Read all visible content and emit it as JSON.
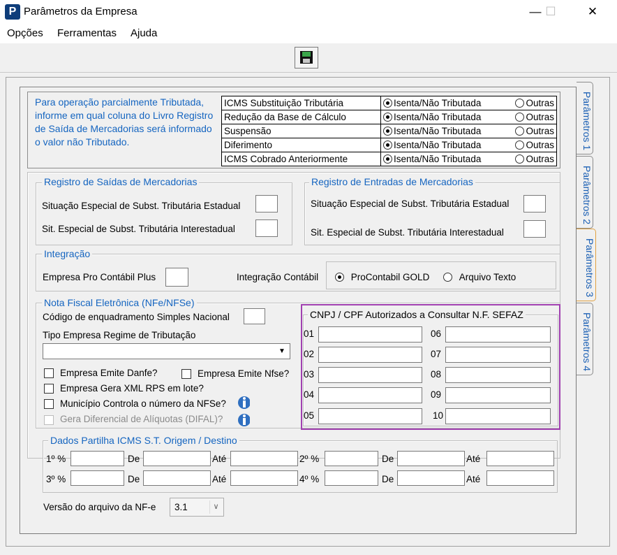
{
  "window": {
    "title": "Parâmetros da Empresa",
    "minimize": "—",
    "maximize": "☐",
    "close": "✕",
    "icon_letter": "P"
  },
  "menu": {
    "items": [
      "Opções",
      "Ferramentas",
      "Ajuda"
    ]
  },
  "toolbar": {
    "save_icon": "floppy-disk-icon"
  },
  "tabs": [
    "Parâmetros 1",
    "Parâmetros 2",
    "Parâmetros 3",
    "Parâmetros 4"
  ],
  "info": {
    "lines": [
      "Para operação parcialmente Tributada,",
      "informe em qual coluna do Livro Registro",
      "de Saída de Mercadorias será informado",
      "o valor não Tributado."
    ]
  },
  "icms_table": {
    "rows": [
      {
        "label": "ICMS Substituição Tributária",
        "opt1": "Isenta/Não Tributada",
        "opt2": "Outras",
        "selected": 1
      },
      {
        "label": "Redução da Base de Cálculo",
        "opt1": "Isenta/Não Tributada",
        "opt2": "Outras",
        "selected": 1
      },
      {
        "label": "Suspensão",
        "opt1": "Isenta/Não Tributada",
        "opt2": "Outras",
        "selected": 1
      },
      {
        "label": "Diferimento",
        "opt1": "Isenta/Não Tributada",
        "opt2": "Outras",
        "selected": 1
      },
      {
        "label": "ICMS Cobrado Anteriormente",
        "opt1": "Isenta/Não Tributada",
        "opt2": "Outras",
        "selected": 1
      }
    ]
  },
  "saidas": {
    "title": "Registro de Saídas de Mercadorias",
    "estadual": "Situação Especial de Subst. Tributária Estadual",
    "interestadual": "Sit. Especial de Subst. Tributária Interestadual"
  },
  "entradas": {
    "title": "Registro de Entradas de Mercadorias",
    "estadual": "Situação Especial de Subst. Tributária Estadual",
    "interestadual": "Sit. Especial de Subst. Tributária Interestadual"
  },
  "integracao": {
    "title": "Integração",
    "empresa_label": "Empresa Pro Contábil Plus",
    "contabil_label": "Integração Contábil",
    "opt1": "ProContabil GOLD",
    "opt2": "Arquivo Texto"
  },
  "nfe": {
    "title": "Nota Fiscal Eletrônica (NFe/NFSe)",
    "codigo_label": "Código de enquadramento Simples Nacional",
    "tipo_label": "Tipo Empresa Regime de Tributação",
    "tipo_value": "",
    "cb_danfe": "Empresa Emite Danfe?",
    "cb_nfse": "Empresa Emite Nfse?",
    "cb_xml": "Empresa Gera XML RPS em lote?",
    "cb_municipio": "Município Controla o número da NFSe?",
    "cb_difal": "Gera Diferencial de Alíquotas (DIFAL)?"
  },
  "cnpj": {
    "title": "CNPJ / CPF Autorizados a Consultar N.F. SEFAZ",
    "left": [
      "01",
      "02",
      "03",
      "04",
      "05"
    ],
    "right": [
      "06",
      "07",
      "08",
      "09",
      "10"
    ]
  },
  "partilha": {
    "title": "Dados Partilha ICMS S.T. Origem / Destino",
    "rows": [
      {
        "a": "1º %",
        "de": "De",
        "ate": "Até",
        "b": "2º %",
        "de2": "De",
        "ate2": "Até"
      },
      {
        "a": "3º %",
        "de": "De",
        "ate": "Até",
        "b": "4º %",
        "de2": "De",
        "ate2": "Até"
      }
    ]
  },
  "versao": {
    "label": "Versão do arquivo da NF-e",
    "value": "3.1"
  }
}
